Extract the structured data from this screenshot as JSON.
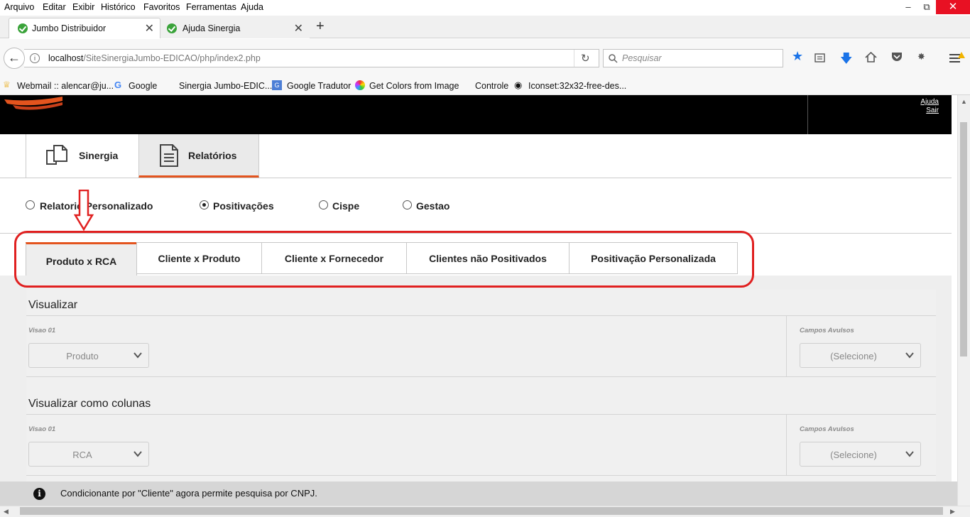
{
  "browser": {
    "menu": [
      "Arquivo",
      "Editar",
      "Exibir",
      "Histórico",
      "Favoritos",
      "Ferramentas",
      "Ajuda"
    ],
    "tabs": [
      {
        "label": "Jumbo Distribuidor"
      },
      {
        "label": "Ajuda Sinergia"
      }
    ],
    "new_tab": "+",
    "url_host": "localhost",
    "url_path": "/SiteSinergiaJumbo-EDICAO/php/index2.php",
    "search_placeholder": "Pesquisar",
    "bookmarks": [
      {
        "label": "Webmail :: alencar@ju...",
        "icon": "crown-icon"
      },
      {
        "label": "Google",
        "icon": "google-icon"
      },
      {
        "label": "Sinergia Jumbo-EDIC...",
        "icon": "check-icon"
      },
      {
        "label": "Google Tradutor",
        "icon": "translate-icon"
      },
      {
        "label": "Get Colors from Image",
        "icon": "color-wheel-icon"
      },
      {
        "label": "Controle",
        "icon": "check-icon"
      },
      {
        "label": "Iconset:32x32-free-des...",
        "icon": "eye-icon"
      }
    ]
  },
  "header": {
    "help": "Ajuda",
    "logout": "Sair"
  },
  "main_tabs": [
    {
      "label": "Sinergia",
      "icon": "copy-icon"
    },
    {
      "label": "Relatórios",
      "icon": "document-icon",
      "active": true
    }
  ],
  "report_types": [
    {
      "label": "Relatorio Personalizado",
      "selected": false
    },
    {
      "label": "Positivações",
      "selected": true
    },
    {
      "label": "Cispe",
      "selected": false
    },
    {
      "label": "Gestao",
      "selected": false
    }
  ],
  "sub_tabs": [
    {
      "label": "Produto x RCA",
      "active": true
    },
    {
      "label": "Cliente x Produto"
    },
    {
      "label": "Cliente x Fornecedor"
    },
    {
      "label": "Clientes não Positivados"
    },
    {
      "label": "Positivação Personalizada"
    }
  ],
  "sections": [
    {
      "title": "Visualizar",
      "left_label": "Visao 01",
      "left_value": "Produto",
      "right_label": "Campos Avulsos",
      "right_value": "(Selecione)"
    },
    {
      "title": "Visualizar como colunas",
      "left_label": "Visao 01",
      "left_value": "RCA",
      "right_label": "Campos Avulsos",
      "right_value": "(Selecione)"
    }
  ],
  "notice": "Condicionante por \"Cliente\" agora permite pesquisa por CNPJ.",
  "colors": {
    "accent": "#e3541e",
    "annotation": "#e02020",
    "header": "#000000"
  }
}
